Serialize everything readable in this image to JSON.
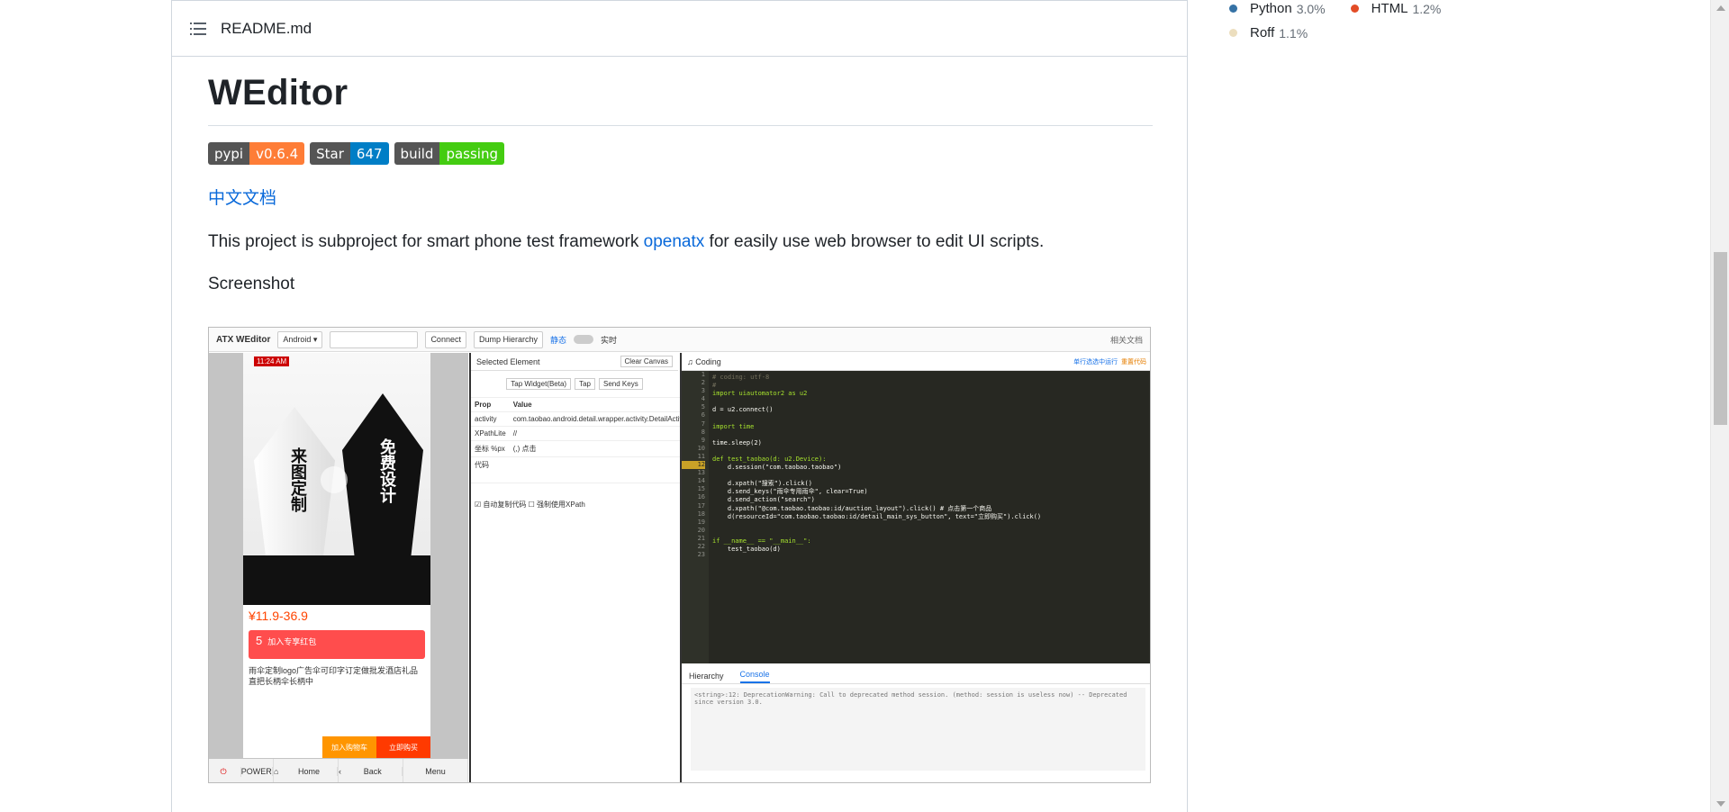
{
  "readme": {
    "file_name": "README.md",
    "title": "WEditor",
    "badges": [
      {
        "label": "pypi",
        "value": "v0.6.4",
        "color": "#fe7d37"
      },
      {
        "label": "Star",
        "value": "647",
        "color": "#007ec6"
      },
      {
        "label": "build",
        "value": "passing",
        "color": "#4c1"
      }
    ],
    "cn_doc_link": "中文文档",
    "desc_prefix": "This project is subproject for smart phone test framework ",
    "desc_link": "openatx",
    "desc_suffix": " for easily use web browser to edit UI scripts.",
    "screenshot_heading": "Screenshot"
  },
  "embedded_screenshot": {
    "logo": "ATX WEditor",
    "platform": "Android",
    "connect_btn": "Connect",
    "dump_btn": "Dump Hierarchy",
    "static_label": "静态",
    "live_label": "实时",
    "docs_menu": "相关文档",
    "phone": {
      "time": "11:24 AM",
      "left_text": "来图定制",
      "right_text": "免费设计",
      "price": "¥11.9-36.9",
      "red_num": "5",
      "red_text": "加入专享红包",
      "desc": "雨伞定制logo广告伞可印字订定做批发酒店礼品直把长柄伞长柄中",
      "add_cart": "加入购物车",
      "buy_now": "立即购买"
    },
    "device_buttons": [
      "POWER",
      "Home",
      "Back",
      "Menu"
    ],
    "element": {
      "header": "Selected Element",
      "clear_btn": "Clear Canvas",
      "actions": [
        "Tap Widget(Beta)",
        "Tap",
        "Send Keys"
      ],
      "col_prop": "Prop",
      "col_value": "Value",
      "rows": [
        {
          "prop": "activity",
          "value": "com.taobao.android.detail.wrapper.activity.DetailActivity"
        },
        {
          "prop": "XPathLite",
          "value": "//"
        },
        {
          "prop": "坐标 %px",
          "value": "(,) 点击"
        }
      ],
      "code_label": "代码",
      "auto_copy": "自动复制代码",
      "force_xpath": "强制使用XPath"
    },
    "coding": {
      "header": "Coding",
      "run_label": "单行选选中运行",
      "reset_label": "重置代码",
      "lines": [
        "# coding: utf-8",
        "#",
        "import uiautomator2 as u2",
        "",
        "d = u2.connect()",
        "",
        "import time",
        "",
        "time.sleep(2)",
        "",
        "def test_taobao(d: u2.Device):",
        "    d.session(\"com.taobao.taobao\")",
        "",
        "    d.xpath(\"搜索\").click()",
        "    d.send_keys(\"雨伞专用雨伞\", clear=True)",
        "    d.send_action(\"search\")",
        "    d.xpath(\"@com.taobao.taobao:id/auction_layout\").click() # 点击第一个商品",
        "    d(resourceId=\"com.taobao.taobao:id/detail_main_sys_button\", text=\"立即购买\").click()",
        "",
        "",
        "if __name__ == \"__main__\":",
        "    test_taobao(d)",
        ""
      ],
      "highlight_line": 12,
      "tab_hierarchy": "Hierarchy",
      "tab_console": "Console",
      "console_text": "<string>:12: DeprecationWarning: Call to deprecated method session. (method: session is useless now) -- Deprecated since version 3.0."
    }
  },
  "languages": [
    {
      "name": "Python",
      "pct": "3.0%",
      "color": "#3572A5"
    },
    {
      "name": "HTML",
      "pct": "1.2%",
      "color": "#e34c26"
    },
    {
      "name": "Roff",
      "pct": "1.1%",
      "color": "#ecdebe"
    }
  ]
}
